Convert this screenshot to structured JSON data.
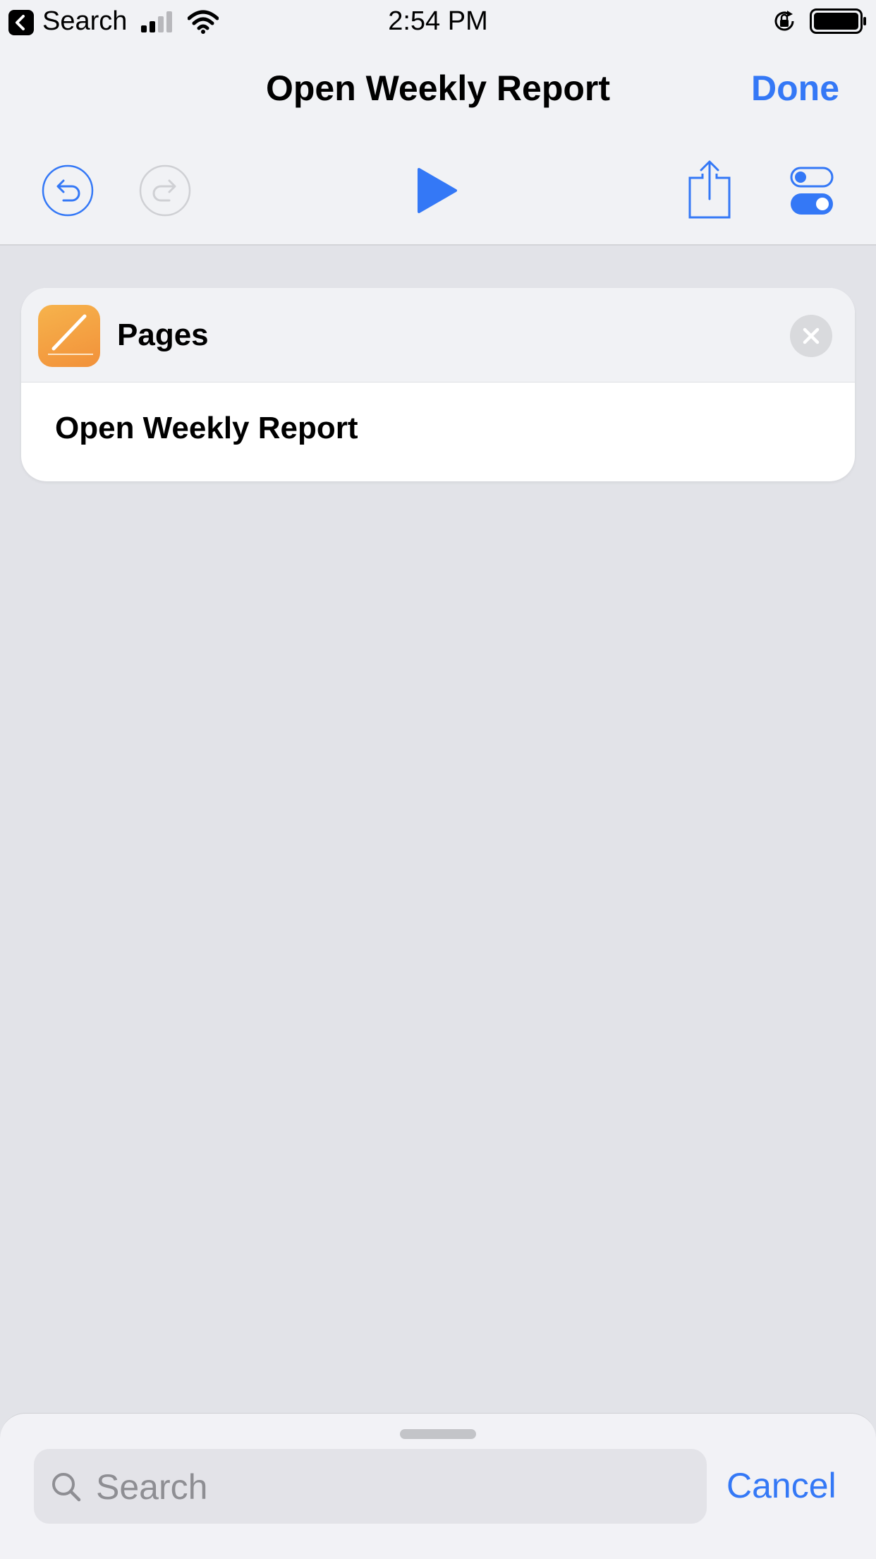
{
  "status_bar": {
    "back_label": "Search",
    "time": "2:54 PM",
    "icons": [
      "back-arrow-icon",
      "cellular-signal-icon",
      "wifi-icon",
      "orientation-lock-icon",
      "battery-icon"
    ]
  },
  "nav": {
    "title": "Open Weekly Report",
    "done_label": "Done"
  },
  "toolbar": {
    "icons": [
      "undo-icon",
      "redo-icon",
      "play-icon",
      "share-icon",
      "settings-toggle-icon"
    ]
  },
  "action": {
    "app_name": "Pages",
    "app_icon": "pages-app-icon",
    "label": "Open Weekly Report"
  },
  "search": {
    "placeholder": "Search",
    "cancel_label": "Cancel"
  },
  "colors": {
    "accent": "#3478f6",
    "background": "#e2e3e8",
    "bar": "#f1f2f5",
    "pages_orange": "#f2913a"
  }
}
